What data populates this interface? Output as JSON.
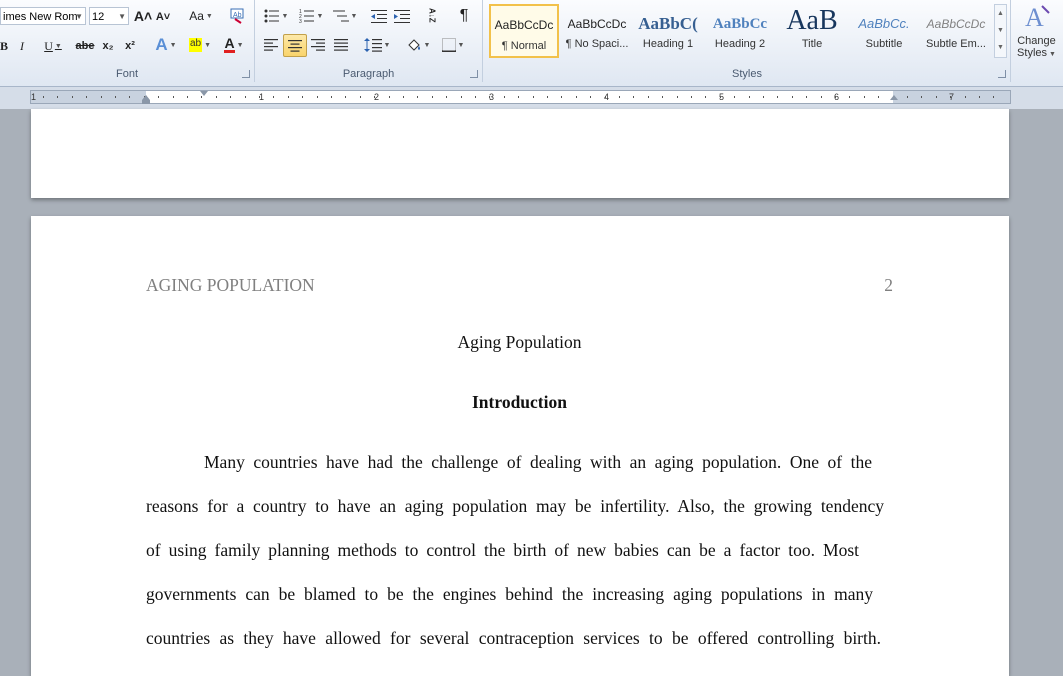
{
  "ribbon": {
    "font": {
      "label": "Font",
      "font_name": "imes New Rom",
      "font_size": "12",
      "grow_icon": "A˄",
      "shrink_icon": "A˅",
      "change_case": "Aa",
      "bold": "B",
      "italic": "I",
      "underline": "U",
      "strike": "abe",
      "subscript": "x₂",
      "superscript": "x²",
      "text_effects": "A",
      "highlight": "ab",
      "font_color": "A"
    },
    "paragraph": {
      "label": "Paragraph",
      "pilcrow": "¶",
      "sort": "A↓Z"
    },
    "styles": {
      "label": "Styles",
      "items": [
        {
          "sample": "AaBbCcDc",
          "name": "¶ Normal"
        },
        {
          "sample": "AaBbCcDc",
          "name": "¶ No Spaci..."
        },
        {
          "sample": "AaBbC(",
          "name": "Heading 1"
        },
        {
          "sample": "AaBbCc",
          "name": "Heading 2"
        },
        {
          "sample": "AaB",
          "name": "Title"
        },
        {
          "sample": "AaBbCc.",
          "name": "Subtitle"
        },
        {
          "sample": "AaBbCcDc",
          "name": "Subtle Em..."
        }
      ],
      "change_styles_line1": "Change",
      "change_styles_line2": "Styles"
    }
  },
  "ruler": {
    "numbers": [
      "1",
      "1",
      "2",
      "3",
      "4",
      "5",
      "6",
      "7"
    ]
  },
  "document": {
    "running_head": "AGING POPULATION",
    "page_number": "2",
    "title": "Aging Population",
    "heading": "Introduction",
    "lines": [
      "Many countries have had the challenge of dealing with an aging population. One of the",
      "reasons for a country to have an aging population may be infertility.  Also, the growing tendency",
      "of using family planning methods to control the birth of new babies can be a factor too. Most",
      "governments can be blamed to be the engines behind the increasing aging populations in many",
      "countries as they have allowed for several contraception services to be offered controlling birth."
    ]
  },
  "colors": {
    "ribbon_bg": "#dfe7f2",
    "workspace": "#a9b0b9",
    "active_style_border": "#f2c14a",
    "header_gray": "#808080"
  }
}
